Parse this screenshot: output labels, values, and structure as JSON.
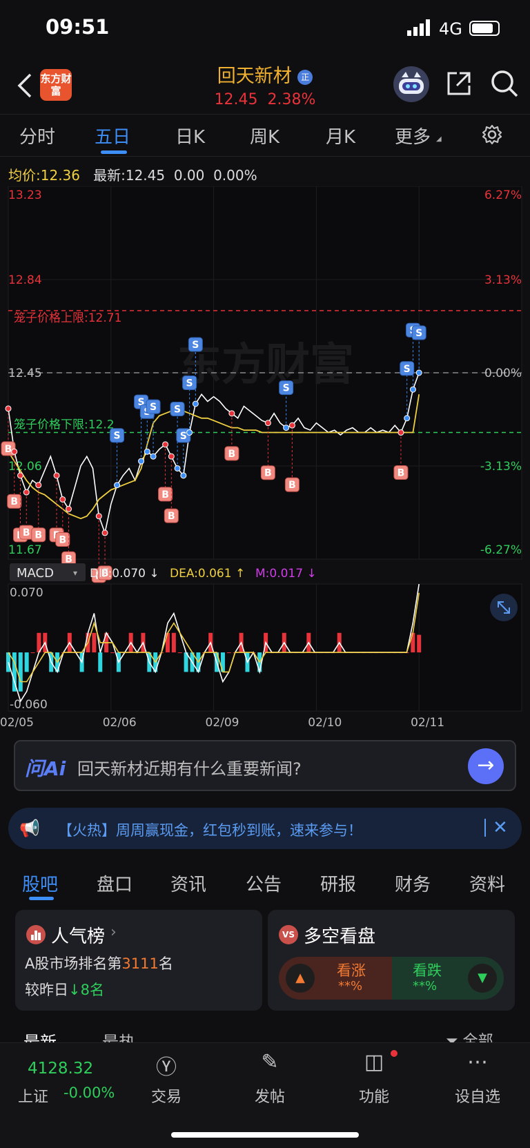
{
  "status_bar": {
    "time": "09:51",
    "network": "4G"
  },
  "header": {
    "logo_text": "东方财富",
    "stock_name": "回天新材",
    "badge": "正",
    "price": "12.45",
    "change_pct": "2.38%"
  },
  "chart_tabs": [
    {
      "label": "分时"
    },
    {
      "label": "五日",
      "active": true
    },
    {
      "label": "日K"
    },
    {
      "label": "周K"
    },
    {
      "label": "月K"
    },
    {
      "label": "更多"
    }
  ],
  "quote_line": {
    "avg_label": "均价:",
    "avg_value": "12.36",
    "latest_label": "最新:",
    "latest_value": "12.45",
    "change": "0.00",
    "change_pct": "0.00%"
  },
  "watermark": "东方财富",
  "chart_data": {
    "type": "line",
    "title": "",
    "x_labels": [
      "02/05",
      "02/06",
      "02/09",
      "02/10",
      "02/11"
    ],
    "price_axis_left": [
      "13.23",
      "12.84",
      "12.45",
      "12.06",
      "11.67"
    ],
    "price_axis_right": [
      "6.27%",
      "3.13%",
      "0.00%",
      "-3.13%",
      "-6.27%"
    ],
    "ylim": [
      11.67,
      13.23
    ],
    "prev_close": 12.45,
    "cage_upper": {
      "label": "笼子价格上限:",
      "value": "12.71"
    },
    "cage_lower": {
      "label": "笼子价格下限:",
      "value": "12.2"
    },
    "series": [
      {
        "name": "price",
        "color": "#ffffff",
        "values": [
          12.3,
          12.12,
          12.02,
          11.95,
          12.0,
          11.98,
          12.04,
          12.1,
          12.02,
          11.92,
          11.88,
          11.97,
          12.06,
          12.1,
          12.05,
          11.85,
          11.78,
          11.9,
          11.98,
          12.02,
          12.05,
          12.0,
          12.08,
          12.12,
          12.1,
          12.13,
          12.15,
          12.1,
          12.05,
          12.02,
          12.2,
          12.32,
          12.36,
          12.33,
          12.35,
          12.33,
          12.3,
          12.28,
          12.26,
          12.31,
          12.29,
          12.27,
          12.25,
          12.24,
          12.28,
          12.24,
          12.22,
          12.23,
          12.26,
          12.22,
          12.21,
          12.24,
          12.22,
          12.2,
          12.21,
          12.19,
          12.21,
          12.22,
          12.2,
          12.2,
          12.22,
          12.2,
          12.21,
          12.2,
          12.23,
          12.2,
          12.26,
          12.38,
          12.45
        ]
      },
      {
        "name": "avg",
        "color": "#f0d040",
        "values": [
          12.12,
          12.08,
          12.04,
          12.0,
          11.97,
          11.95,
          11.94,
          11.92,
          11.9,
          11.88,
          11.86,
          11.85,
          11.84,
          11.85,
          11.88,
          11.92,
          11.94,
          11.96,
          11.97,
          11.98,
          11.99,
          12.0,
          12.05,
          12.15,
          12.24,
          12.27,
          12.28,
          12.29,
          12.29,
          12.29,
          12.28,
          12.27,
          12.26,
          12.26,
          12.25,
          12.24,
          12.23,
          12.22,
          12.22,
          12.21,
          12.21,
          12.21,
          12.2,
          12.2,
          12.2,
          12.2,
          12.2,
          12.2,
          12.2,
          12.2,
          12.2,
          12.2,
          12.2,
          12.2,
          12.2,
          12.2,
          12.2,
          12.2,
          12.2,
          12.2,
          12.2,
          12.2,
          12.2,
          12.2,
          12.2,
          12.2,
          12.2,
          12.2,
          12.36
        ]
      }
    ],
    "markers": [
      {
        "type": "B",
        "i": 0
      },
      {
        "type": "B",
        "i": 1
      },
      {
        "type": "B",
        "i": 2
      },
      {
        "type": "B",
        "i": 3
      },
      {
        "type": "B",
        "i": 5
      },
      {
        "type": "B",
        "i": 8
      },
      {
        "type": "B",
        "i": 9
      },
      {
        "type": "B",
        "i": 10
      },
      {
        "type": "B",
        "i": 15
      },
      {
        "type": "B",
        "i": 16
      },
      {
        "type": "B",
        "i": 26
      },
      {
        "type": "B",
        "i": 27
      },
      {
        "type": "B",
        "i": 37
      },
      {
        "type": "B",
        "i": 43
      },
      {
        "type": "B",
        "i": 47
      },
      {
        "type": "B",
        "i": 65
      },
      {
        "type": "S",
        "i": 18
      },
      {
        "type": "S",
        "i": 22
      },
      {
        "type": "S",
        "i": 23
      },
      {
        "type": "S",
        "i": 24
      },
      {
        "type": "S",
        "i": 28
      },
      {
        "type": "S",
        "i": 29
      },
      {
        "type": "S",
        "i": 30
      },
      {
        "type": "S",
        "i": 31
      },
      {
        "type": "S",
        "i": 46
      },
      {
        "type": "S",
        "i": 66
      },
      {
        "type": "S",
        "i": 67
      },
      {
        "type": "S",
        "i": 68
      }
    ],
    "macd": {
      "indicator": "MACD",
      "dif_label": "DIF:0.070 ↓",
      "dea_label": "DEA:0.061 ↑",
      "m_label": "M:0.017 ↓",
      "y_top": "0.070",
      "y_bottom": "-0.060",
      "ylim": [
        -0.06,
        0.07
      ],
      "dif": [
        -0.01,
        -0.03,
        -0.05,
        -0.04,
        -0.02,
        0.0,
        0.01,
        -0.01,
        -0.02,
        0.0,
        0.01,
        0.0,
        -0.01,
        0.02,
        0.04,
        0.0,
        0.02,
        0.01,
        -0.01,
        0.0,
        0.01,
        0.0,
        0.01,
        -0.01,
        -0.02,
        0.0,
        0.03,
        0.04,
        0.02,
        0.0,
        -0.01,
        -0.02,
        0.0,
        0.01,
        -0.01,
        -0.03,
        -0.02,
        0.0,
        0.01,
        -0.01,
        0.0,
        -0.02,
        0.01,
        0.0,
        0.0,
        0.01,
        0.0,
        0.0,
        0.0,
        0.01,
        0.0,
        0.0,
        0.0,
        0.0,
        0.01,
        0.0,
        0.0,
        0.0,
        0.0,
        0.0,
        0.0,
        0.0,
        0.0,
        0.0,
        0.0,
        0.0,
        0.03,
        0.07
      ],
      "dea": [
        0.0,
        -0.01,
        -0.03,
        -0.03,
        -0.02,
        -0.01,
        0.0,
        0.0,
        -0.01,
        0.0,
        0.0,
        0.0,
        0.0,
        0.01,
        0.03,
        0.01,
        0.01,
        0.01,
        0.0,
        0.0,
        0.0,
        0.0,
        0.0,
        0.0,
        -0.01,
        0.0,
        0.02,
        0.03,
        0.02,
        0.01,
        0.0,
        -0.01,
        0.0,
        0.0,
        0.0,
        -0.02,
        -0.02,
        0.0,
        0.0,
        0.0,
        0.0,
        -0.01,
        0.0,
        0.0,
        0.0,
        0.0,
        0.0,
        0.0,
        0.0,
        0.0,
        0.0,
        0.0,
        0.0,
        0.0,
        0.0,
        0.0,
        0.0,
        0.0,
        0.0,
        0.0,
        0.0,
        0.0,
        0.0,
        0.0,
        0.0,
        0.0,
        0.02,
        0.061
      ]
    }
  },
  "ai_bar": {
    "icon_text": "问Ai",
    "prompt": "回天新材近期有什么重要新闻?"
  },
  "notice": {
    "text": "【火热】周周赢现金，红包秒到账，速来参与！"
  },
  "content_tabs": [
    {
      "label": "股吧",
      "active": true
    },
    {
      "label": "盘口"
    },
    {
      "label": "资讯"
    },
    {
      "label": "公告"
    },
    {
      "label": "研报"
    },
    {
      "label": "财务"
    },
    {
      "label": "资料"
    }
  ],
  "popularity_card": {
    "title": "人气榜",
    "rank_prefix": "A股市场排名第",
    "rank": "3111",
    "rank_suffix": "名",
    "change_prefix": "较昨日",
    "change_value": "8名"
  },
  "sentiment_card": {
    "title": "多空看盘",
    "bull_label": "看涨",
    "bull_value": "**%",
    "bear_label": "看跌",
    "bear_value": "**%"
  },
  "feed_tabs": {
    "latest": "最新",
    "hot": "最热",
    "filter": "全部"
  },
  "bottom_nav": {
    "index_value": "4128.32",
    "index_name": "上证",
    "index_change": "-0.00%",
    "items": [
      {
        "label": "交易"
      },
      {
        "label": "发帖"
      },
      {
        "label": "功能"
      },
      {
        "label": "设自选"
      }
    ]
  }
}
